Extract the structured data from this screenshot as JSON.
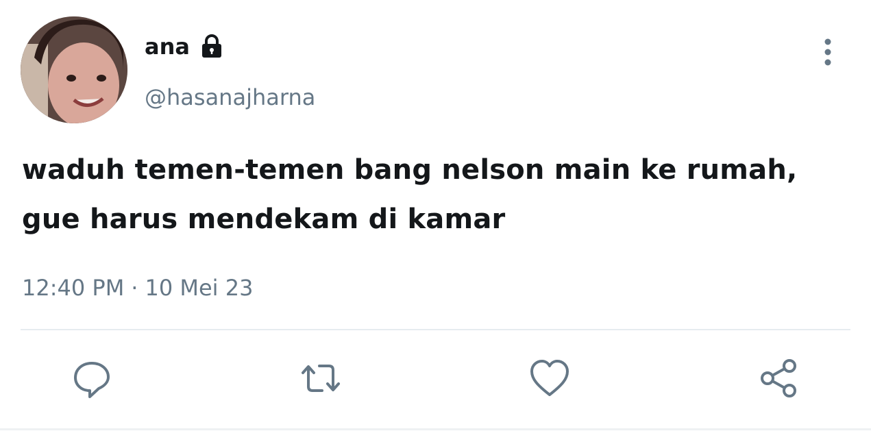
{
  "tweet": {
    "author": {
      "display_name": "ana",
      "handle": "@hasanajharna",
      "protected_icon": "lock-icon",
      "avatar_icon": "avatar"
    },
    "text": "waduh temen-temen bang nelson main ke rumah, gue harus mendekam di kamar",
    "time": "12:40 PM",
    "separator": "·",
    "date": "10 Mei 23"
  },
  "actions": {
    "reply_icon": "reply-icon",
    "retweet_icon": "retweet-icon",
    "like_icon": "heart-icon",
    "share_icon": "share-icon",
    "more_icon": "more-vertical-icon"
  },
  "colors": {
    "text_primary": "#14171a",
    "text_secondary": "#657786",
    "divider": "#e6ecf0"
  }
}
